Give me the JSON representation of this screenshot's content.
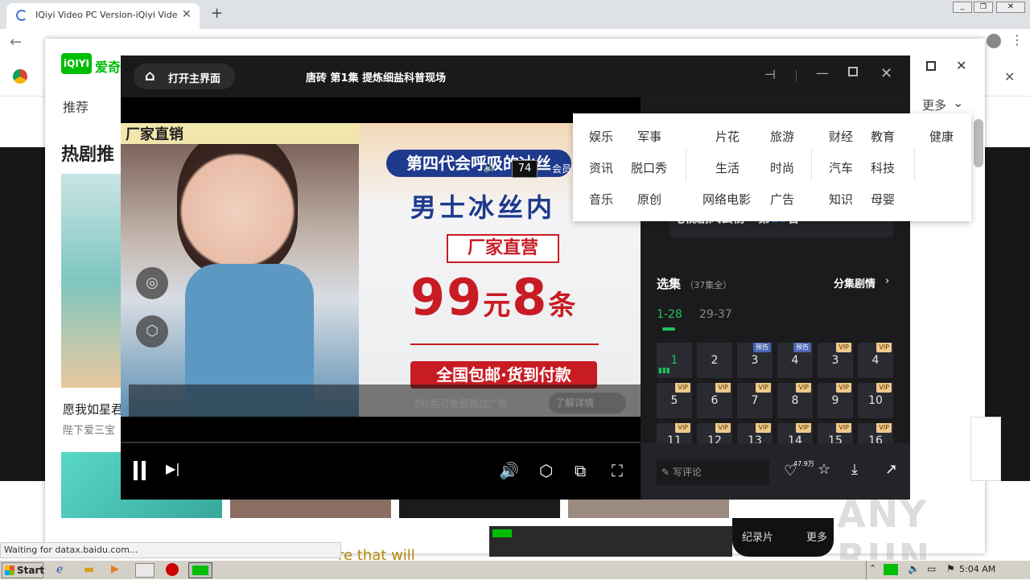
{
  "browser": {
    "tab_title": "IQiyi Video PC Version-iQiyi Video Of",
    "status": "Waiting for datax.baidu.com..."
  },
  "web": {
    "logo": "爱奇",
    "nav_recommend": "推荐",
    "more": "更多",
    "section_hot": "热剧推",
    "card_title": "愿我如星君",
    "card_sub": "陛下爱三宝",
    "bottom_text": "re that will"
  },
  "player": {
    "home_label": "打开主界面",
    "title": "唐砖 第1集 提炼细盐科普现场",
    "ad": {
      "left_header": "厂家直销",
      "counter": "74",
      "vip": "会员",
      "line1": "第四代会呼吸的冰丝",
      "line2": "男士冰丝内",
      "line3": "厂家直营",
      "price_num": "99",
      "price_unit": "元",
      "price_count": "8",
      "price_suffix": "条",
      "line4": "全国包邮·货到付款",
      "skip": "5秒后可免费跳过广告",
      "learn_more": "了解详情"
    },
    "ranking": {
      "prefix": "电视剧风云榜 · 第",
      "num": "18",
      "suffix": "名"
    },
    "episodes": {
      "title": "选集",
      "count": "（37集全）",
      "plot": "分集剧情",
      "range_active": "1-28",
      "range_other": "29-37",
      "items": [
        {
          "n": "1",
          "badge": "",
          "active": true
        },
        {
          "n": "2",
          "badge": ""
        },
        {
          "n": "3",
          "badge": "预告"
        },
        {
          "n": "4",
          "badge": "预告"
        },
        {
          "n": "3",
          "badge": "VIP"
        },
        {
          "n": "4",
          "badge": "VIP"
        },
        {
          "n": "5",
          "badge": "VIP"
        },
        {
          "n": "6",
          "badge": "VIP"
        },
        {
          "n": "7",
          "badge": "VIP"
        },
        {
          "n": "8",
          "badge": "VIP"
        },
        {
          "n": "9",
          "badge": "VIP"
        },
        {
          "n": "10",
          "badge": "VIP"
        },
        {
          "n": "11",
          "badge": "VIP"
        },
        {
          "n": "12",
          "badge": "VIP"
        },
        {
          "n": "13",
          "badge": "VIP"
        },
        {
          "n": "14",
          "badge": "VIP"
        },
        {
          "n": "15",
          "badge": "VIP"
        },
        {
          "n": "16",
          "badge": "VIP"
        }
      ]
    },
    "comment_placeholder": "写评论",
    "likes": "47.9万"
  },
  "categories": [
    "娱乐",
    "军事",
    "片花",
    "旅游",
    "财经",
    "教育",
    "健康",
    "资讯",
    "脱口秀",
    "生活",
    "时尚",
    "汽车",
    "科技",
    "音乐",
    "原创",
    "网络电影",
    "广告",
    "知识",
    "母婴"
  ],
  "thumbnail": {
    "doc": "纪录片",
    "more": "更多"
  },
  "taskbar": {
    "start": "Start",
    "time": "5:04 AM"
  },
  "watermark": "ANY RUN"
}
